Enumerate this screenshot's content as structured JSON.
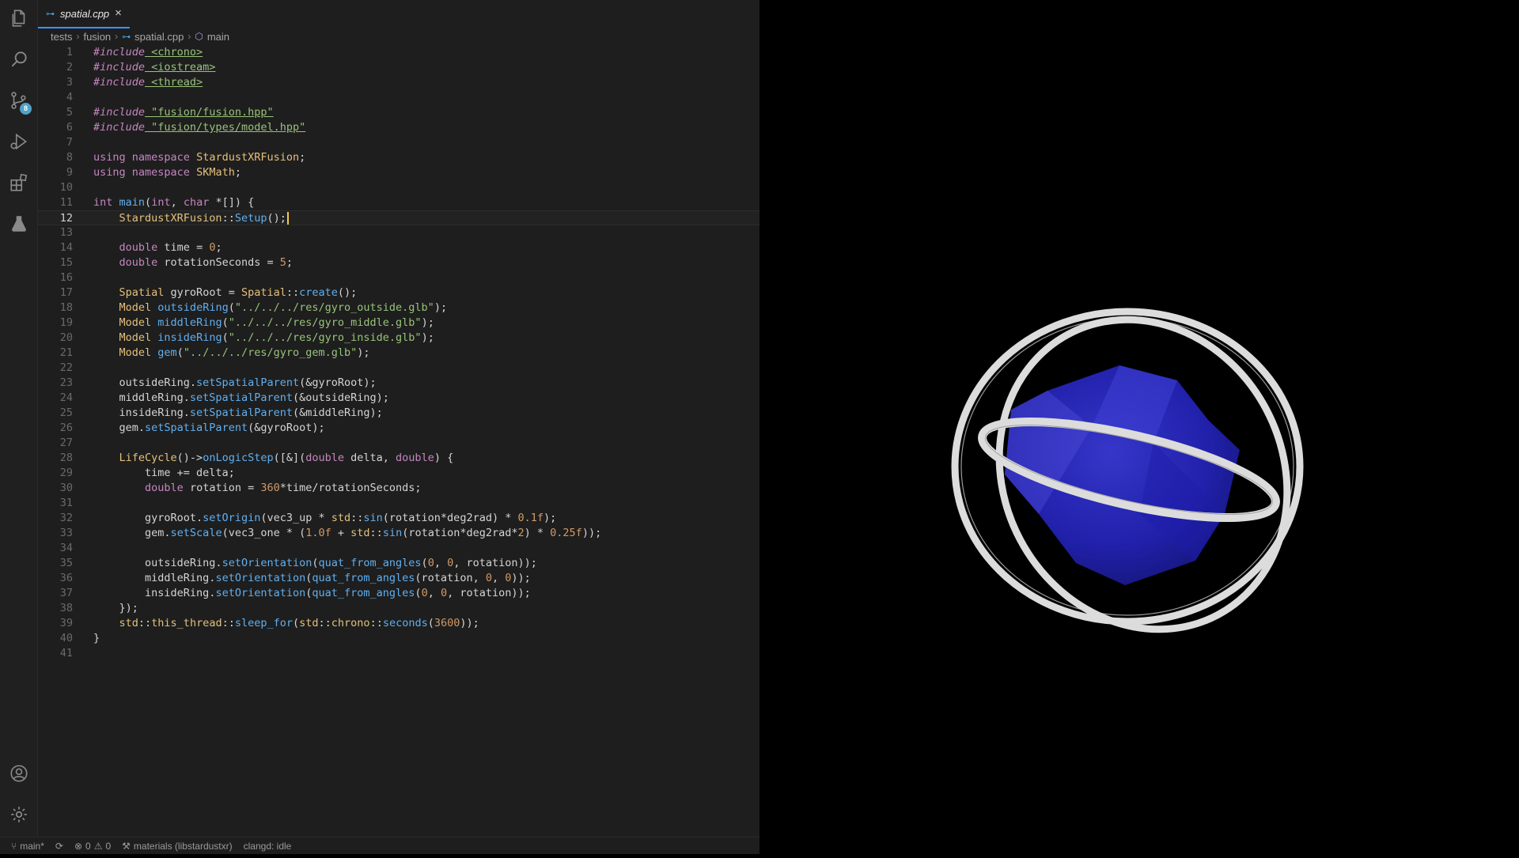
{
  "activity_bar": {
    "scm_badge": "8"
  },
  "tab": {
    "filename": "spatial.cpp",
    "close_glyph": "×"
  },
  "breadcrumb": [
    "tests",
    "fusion",
    "spatial.cpp",
    "main"
  ],
  "editor": {
    "current_line": 12,
    "lines": [
      "#include <chrono>",
      "#include <iostream>",
      "#include <thread>",
      "",
      "#include \"fusion/fusion.hpp\"",
      "#include \"fusion/types/model.hpp\"",
      "",
      "using namespace StardustXRFusion;",
      "using namespace SKMath;",
      "",
      "int main(int, char *[]) {",
      "    StardustXRFusion::Setup();",
      "",
      "    double time = 0;",
      "    double rotationSeconds = 5;",
      "",
      "    Spatial gyroRoot = Spatial::create();",
      "    Model outsideRing(\"../../../res/gyro_outside.glb\");",
      "    Model middleRing(\"../../../res/gyro_middle.glb\");",
      "    Model insideRing(\"../../../res/gyro_inside.glb\");",
      "    Model gem(\"../../../res/gyro_gem.glb\");",
      "",
      "    outsideRing.setSpatialParent(&gyroRoot);",
      "    middleRing.setSpatialParent(&outsideRing);",
      "    insideRing.setSpatialParent(&middleRing);",
      "    gem.setSpatialParent(&gyroRoot);",
      "",
      "    LifeCycle()->onLogicStep([&](double delta, double) {",
      "        time += delta;",
      "        double rotation = 360*time/rotationSeconds;",
      "",
      "        gyroRoot.setOrigin(vec3_up * std::sin(rotation*deg2rad) * 0.1f);",
      "        gem.setScale(vec3_one * (1.0f + std::sin(rotation*deg2rad*2) * 0.25f));",
      "",
      "        outsideRing.setOrientation(quat_from_angles(0, 0, rotation));",
      "        middleRing.setOrientation(quat_from_angles(rotation, 0, 0));",
      "        insideRing.setOrientation(quat_from_angles(0, 0, rotation));",
      "    });",
      "    std::this_thread::sleep_for(std::chrono::seconds(3600));",
      "}",
      ""
    ]
  },
  "statusbar": {
    "branch": "main*",
    "errors": "0",
    "warnings": "0",
    "project": "materials (libstardustxr)",
    "clangd": "clangd: idle"
  },
  "viewport": {
    "ring_color": "#dcdcdc",
    "gem_color": "#2a2abf"
  }
}
